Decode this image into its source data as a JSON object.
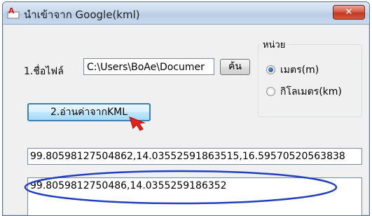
{
  "window": {
    "title": "นำเข้าจาก Google(kml)",
    "close_label": "✕"
  },
  "file": {
    "label": "1.ชื่อไฟล์",
    "path_value": "C:\\Users\\BoAe\\Documer",
    "browse_label": "ค้น"
  },
  "actions": {
    "read_kml_label": "2.อ่านค่าจากKML"
  },
  "units": {
    "group_title": "หน่วย",
    "options": [
      {
        "label": "เมตร(m)",
        "selected": true
      },
      {
        "label": "กิโลเมตร(km)",
        "selected": false
      }
    ]
  },
  "output": {
    "raw_coords": "99.80598127504862,14.03552591863515,16.59570520563838",
    "parsed_coords": "99.8059812750486,14.0355259186352"
  },
  "colors": {
    "highlight_ellipse": "#1f3fbf",
    "cursor_arrow": "#e8201a"
  }
}
